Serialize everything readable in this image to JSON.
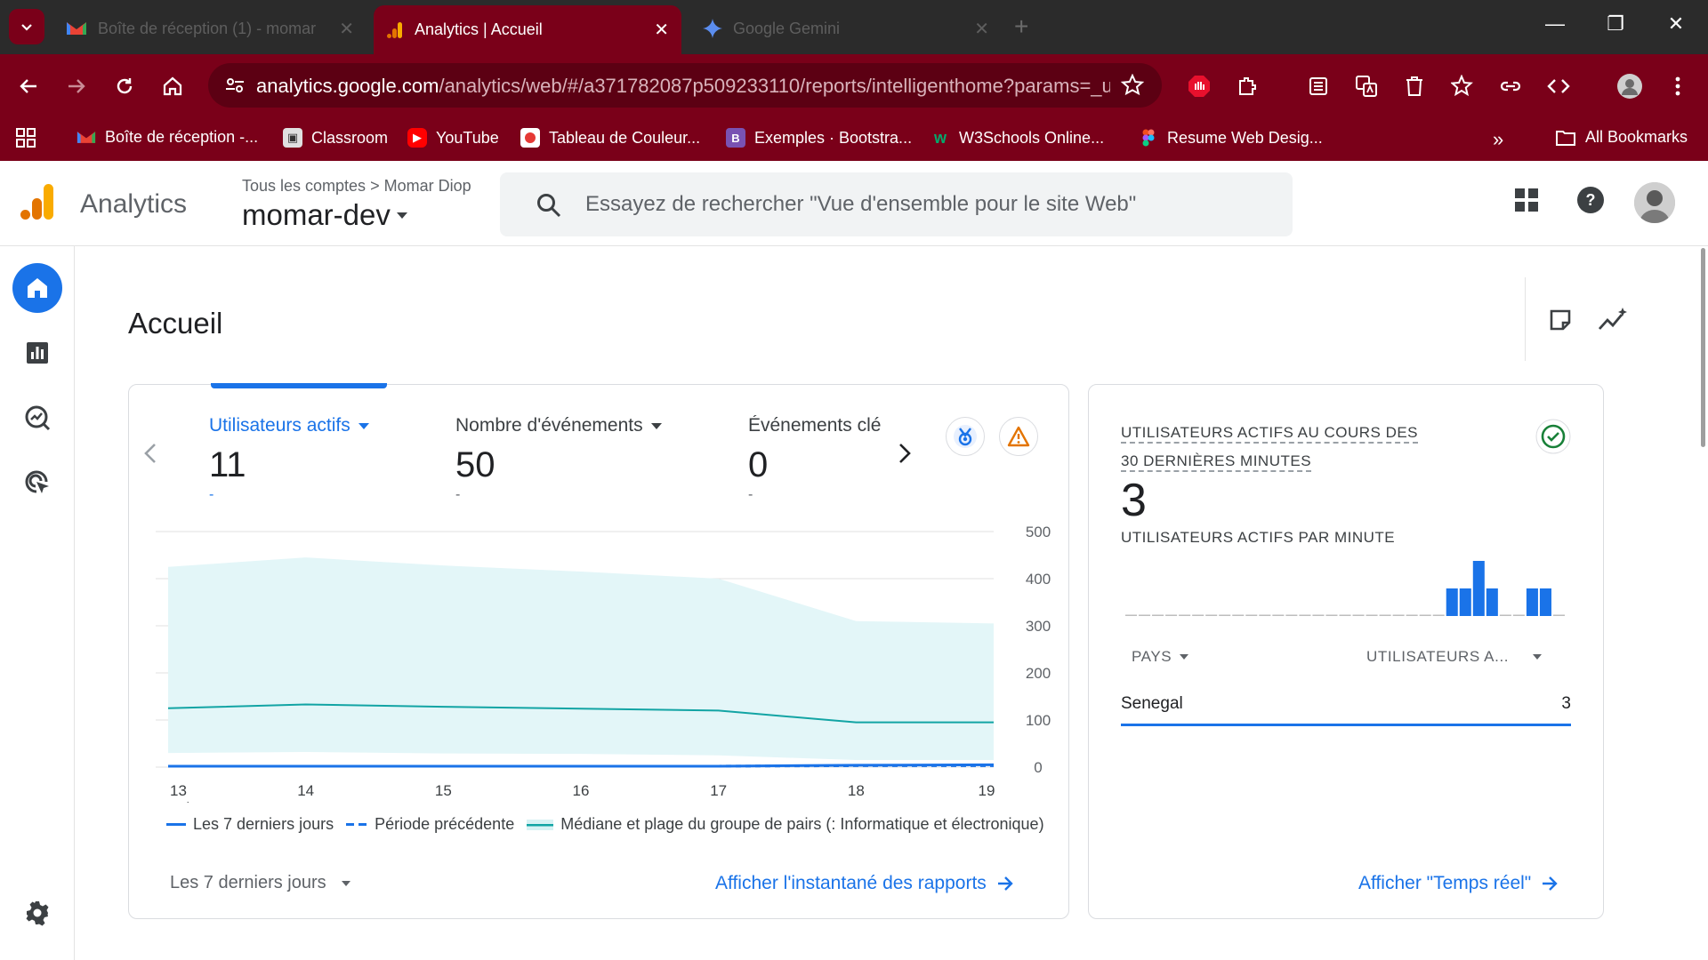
{
  "browser": {
    "tabs": [
      {
        "title": "Boîte de réception (1) - momar",
        "active": false
      },
      {
        "title": "Analytics | Accueil",
        "active": true
      },
      {
        "title": "Google Gemini",
        "active": false
      }
    ],
    "url_host": "analytics.google.com",
    "url_path": "/analytics/web/#/a371782087p509233110/reports/intelligenthome?params=_u....",
    "bookmarks": [
      "Boîte de réception -...",
      "Classroom",
      "YouTube",
      "Tableau de Couleur...",
      "Exemples · Bootstra...",
      "W3Schools Online...",
      "Resume Web Desig..."
    ],
    "all_bookmarks": "All Bookmarks",
    "colors": {
      "chrome": "#7a0019",
      "tabbar": "#2b2b2b"
    }
  },
  "header": {
    "app_name": "Analytics",
    "breadcrumb_root": "Tous les comptes",
    "breadcrumb_account": "Momar Diop",
    "property": "momar-dev",
    "search_placeholder": "Essayez de rechercher \"Vue d'ensemble pour le site Web\""
  },
  "page": {
    "title": "Accueil"
  },
  "overview": {
    "metrics": [
      {
        "label": "Utilisateurs actifs",
        "value": "11",
        "delta": "-",
        "selected": true
      },
      {
        "label": "Nombre d'événements",
        "value": "50",
        "delta": "-",
        "selected": false
      },
      {
        "label": "Événements clé",
        "value": "0",
        "delta": "-",
        "selected": false
      }
    ],
    "legend": {
      "current": "Les 7 derniers jours",
      "previous": "Période précédente",
      "peers": "Médiane et plage du groupe de pairs (: Informatique et électronique)"
    },
    "date_range": "Les 7 derniers jours",
    "link": "Afficher l'instantané des rapports"
  },
  "chart_data": {
    "type": "line",
    "x": [
      "13",
      "14",
      "15",
      "16",
      "17",
      "18",
      "19"
    ],
    "x_first_sublabel": "oct.",
    "ylim": [
      0,
      500
    ],
    "y_ticks": [
      "0",
      "100",
      "200",
      "300",
      "400",
      "500"
    ],
    "series": [
      {
        "name": "Les 7 derniers jours",
        "values": [
          2,
          2,
          2,
          2,
          2,
          4,
          5
        ]
      },
      {
        "name": "Période précédente",
        "values": [
          2,
          2,
          2,
          2,
          2,
          3,
          3
        ]
      },
      {
        "name": "Médiane et plage du groupe de pairs (: Informatique et électronique)",
        "values": [
          125,
          133,
          128,
          124,
          120,
          95,
          95
        ]
      }
    ],
    "peer_band": {
      "upper": [
        425,
        445,
        428,
        415,
        400,
        310,
        305
      ],
      "lower": [
        30,
        32,
        29,
        28,
        25,
        15,
        15
      ]
    },
    "colors": {
      "current": "#1a73e8",
      "median": "#12a4a4",
      "band": "#e3f6f8"
    }
  },
  "realtime": {
    "title_line1": "UTILISATEURS ACTIFS AU COURS DES",
    "title_line2": "30 DERNIÈRES MINUTES",
    "value": "3",
    "subtitle": "UTILISATEURS ACTIFS PAR MINUTE",
    "per_minute": [
      0,
      0,
      0,
      0,
      0,
      0,
      0,
      0,
      0,
      0,
      0,
      0,
      0,
      0,
      0,
      0,
      0,
      0,
      0,
      0,
      0,
      0,
      0,
      0,
      1,
      1,
      2,
      1,
      0,
      0,
      1,
      1,
      0
    ],
    "col_country": "PAYS",
    "col_users": "UTILISATEURS A...",
    "rows": [
      {
        "country": "Senegal",
        "users": "3"
      }
    ],
    "link": "Afficher \"Temps réel\""
  }
}
